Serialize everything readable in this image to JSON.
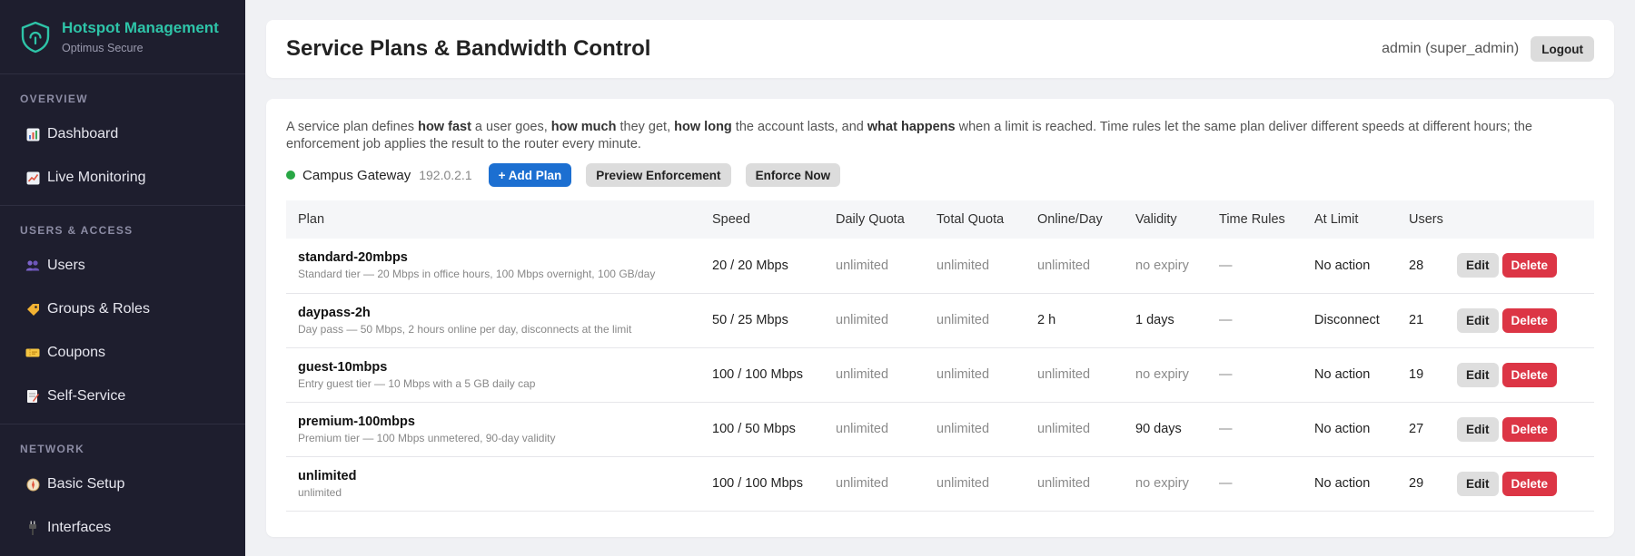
{
  "brand": {
    "title": "Hotspot Management",
    "subtitle": "Optimus Secure"
  },
  "sidebar": {
    "sections": [
      {
        "heading": "OVERVIEW",
        "items": [
          {
            "label": "Dashboard",
            "icon": "bar-chart-icon"
          },
          {
            "label": "Live Monitoring",
            "icon": "trend-chart-icon"
          }
        ]
      },
      {
        "heading": "USERS & ACCESS",
        "items": [
          {
            "label": "Users",
            "icon": "users-icon"
          },
          {
            "label": "Groups & Roles",
            "icon": "tag-icon"
          },
          {
            "label": "Coupons",
            "icon": "ticket-icon"
          },
          {
            "label": "Self-Service",
            "icon": "memo-icon"
          }
        ]
      },
      {
        "heading": "NETWORK",
        "items": [
          {
            "label": "Basic Setup",
            "icon": "compass-icon"
          },
          {
            "label": "Interfaces",
            "icon": "plug-icon"
          }
        ]
      }
    ]
  },
  "header": {
    "title": "Service Plans & Bandwidth Control",
    "user": "admin (super_admin)",
    "logout_label": "Logout"
  },
  "intro": {
    "p1": "A service plan defines ",
    "b1": "how fast",
    "p2": " a user goes, ",
    "b2": "how much",
    "p3": " they get, ",
    "b3": "how long",
    "p4": " the account lasts, and ",
    "b4": "what happens",
    "p5": " when a limit is reached. Time rules let the same plan deliver different speeds at different hours; the enforcement job applies the result to the router every minute."
  },
  "toolbar": {
    "router_name": "Campus Gateway",
    "router_ip": "192.0.2.1",
    "router_status_color": "#28a745",
    "add_plan_label": "+ Add Plan",
    "preview_label": "Preview Enforcement",
    "enforce_label": "Enforce Now"
  },
  "table": {
    "columns": [
      "Plan",
      "Speed",
      "Daily Quota",
      "Total Quota",
      "Online/Day",
      "Validity",
      "Time Rules",
      "At Limit",
      "Users"
    ],
    "edit_label": "Edit",
    "delete_label": "Delete",
    "rows": [
      {
        "name": "standard-20mbps",
        "desc": "Standard tier — 20 Mbps in office hours, 100 Mbps overnight, 100 GB/day",
        "speed": "20 / 20 Mbps",
        "daily": "unlimited",
        "total": "unlimited",
        "online": "unlimited",
        "validity": "no expiry",
        "rules": "—",
        "at_limit": "No action",
        "users": "28"
      },
      {
        "name": "daypass-2h",
        "desc": "Day pass — 50 Mbps, 2 hours online per day, disconnects at the limit",
        "speed": "50 / 25 Mbps",
        "daily": "unlimited",
        "total": "unlimited",
        "online": "2 h",
        "validity": "1 days",
        "rules": "—",
        "at_limit": "Disconnect",
        "users": "21"
      },
      {
        "name": "guest-10mbps",
        "desc": "Entry guest tier — 10 Mbps with a 5 GB daily cap",
        "speed": "100 / 100 Mbps",
        "daily": "unlimited",
        "total": "unlimited",
        "online": "unlimited",
        "validity": "no expiry",
        "rules": "—",
        "at_limit": "No action",
        "users": "19"
      },
      {
        "name": "premium-100mbps",
        "desc": "Premium tier — 100 Mbps unmetered, 90-day validity",
        "speed": "100 / 50 Mbps",
        "daily": "unlimited",
        "total": "unlimited",
        "online": "unlimited",
        "validity": "90 days",
        "rules": "—",
        "at_limit": "No action",
        "users": "27"
      },
      {
        "name": "unlimited",
        "desc": "unlimited",
        "speed": "100 / 100 Mbps",
        "daily": "unlimited",
        "total": "unlimited",
        "online": "unlimited",
        "validity": "no expiry",
        "rules": "—",
        "at_limit": "No action",
        "users": "29"
      }
    ]
  }
}
